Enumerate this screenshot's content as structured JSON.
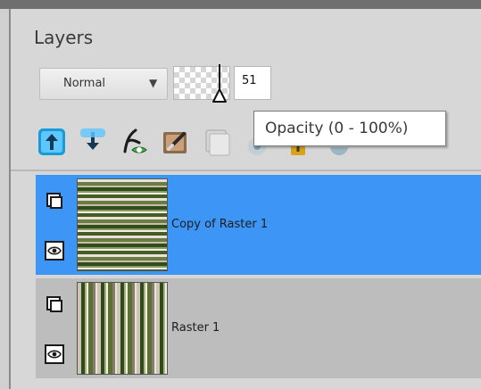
{
  "panel": {
    "title": "Layers"
  },
  "blend": {
    "mode": "Normal",
    "dropdown_icon": "triangle-down"
  },
  "opacity": {
    "value": "51",
    "percent": 51,
    "tooltip": "Opacity (0 - 100%)"
  },
  "toolbar": {
    "tools": [
      {
        "name": "move-layer-up-icon",
        "color": "#1a9bd7"
      },
      {
        "name": "move-layer-down-icon",
        "color": "#1a9bd7"
      },
      {
        "name": "layer-effects-icon",
        "color": "#4caf50"
      },
      {
        "name": "edit-layer-icon",
        "color": "#8b6b4a"
      },
      {
        "name": "duplicate-layer-icon",
        "color": "#b0b0b0"
      },
      {
        "name": "visibility-toggle-icon",
        "color": "#6b9bb0"
      },
      {
        "name": "lock-icon",
        "color": "#d8a21b"
      },
      {
        "name": "globe-icon",
        "color": "#6b9bb0"
      }
    ]
  },
  "layers": [
    {
      "name": "Copy of Raster 1",
      "selected": true,
      "thumbnail": "horizontal-stripes"
    },
    {
      "name": "Raster 1",
      "selected": false,
      "thumbnail": "vertical-stripes"
    }
  ],
  "colors": {
    "selection": "#3d96f5",
    "panel": "#d7d7d7"
  }
}
